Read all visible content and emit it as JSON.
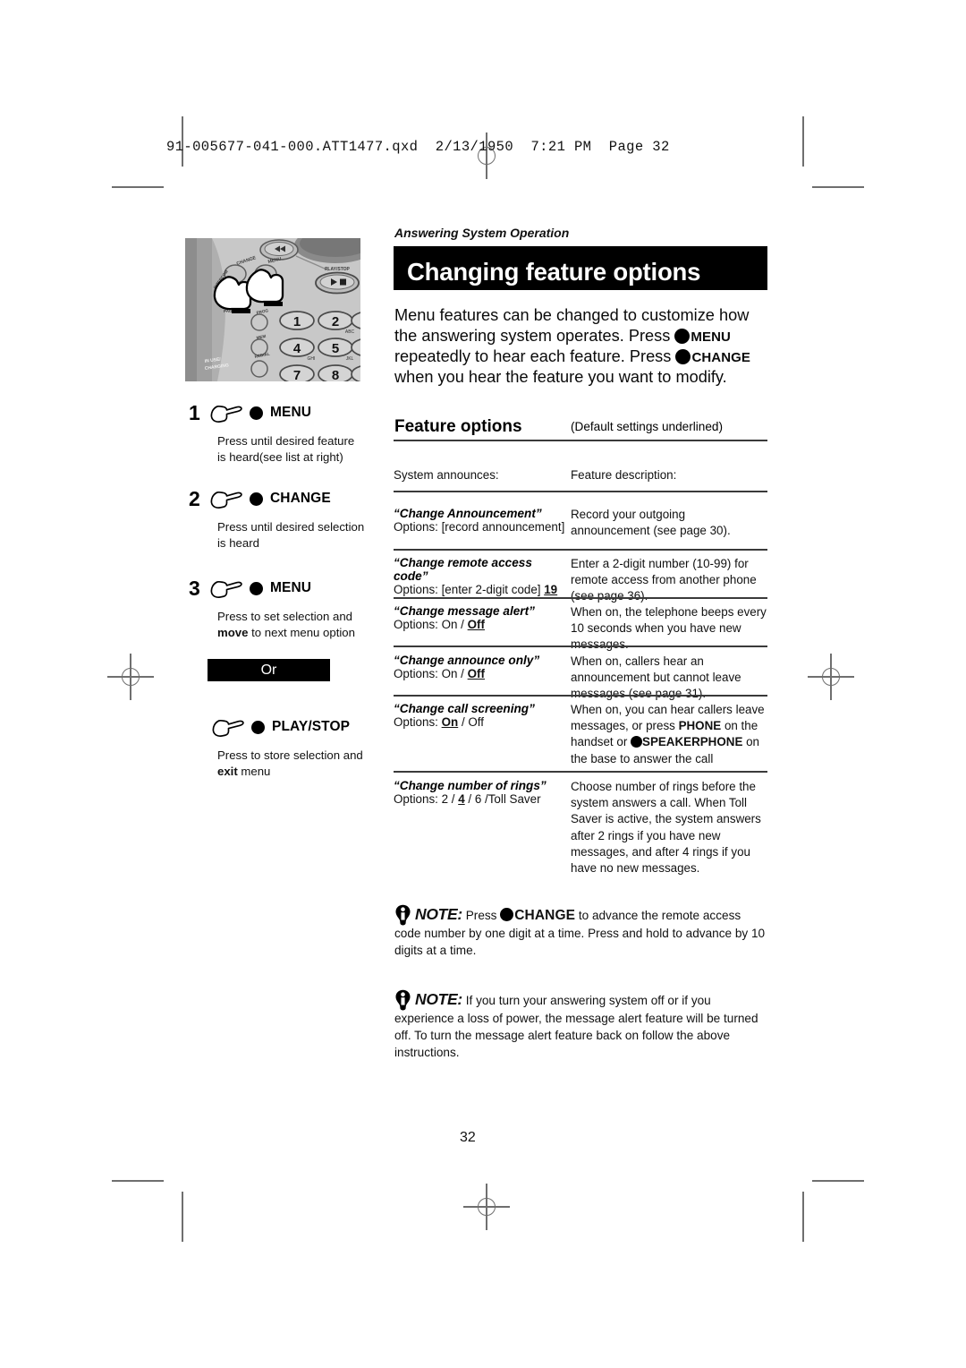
{
  "print_slug": "91-005677-041-000.ATT1477.qxd  2/13/1950  7:21 PM  Page 32",
  "running_head": "Answering System Operation",
  "title": "Changing feature options",
  "intro": {
    "part1": "Menu features can be changed to customize how the answering system operates. Press",
    "key1": "MENU",
    "part2": "repeatedly to hear each feature. Press",
    "key2": "CHANGE",
    "part3": "when you hear the feature you want to modify."
  },
  "steps": [
    {
      "number": "1",
      "key": "MENU",
      "body_line1": "Press until desired feature",
      "body_line2": "is heard(see list at right)",
      "body_bold": ""
    },
    {
      "number": "2",
      "key": "CHANGE",
      "body_line1": "Press until desired selection",
      "body_line2": "is heard",
      "body_bold": ""
    },
    {
      "number": "3",
      "key": "MENU",
      "body_line1": "Press to set selection and",
      "body_bold": "move",
      "body_line2": "to next menu option"
    }
  ],
  "or_label": "Or",
  "alt_step": {
    "key": "PLAY/STOP",
    "body_line1": "Press to store selection and",
    "body_bold": "exit",
    "body_line2": "menu"
  },
  "phone_art": {
    "labels": [
      "CHANGE",
      "MENU",
      "PLAY/STOP",
      "INTERCOM",
      "PAGE",
      "PROG",
      "MEM",
      "REDIAL",
      "IN USE/CHARGING"
    ],
    "keys": [
      "1",
      "2",
      "4",
      "5",
      "7",
      "8"
    ],
    "key_letters": [
      "ABC",
      "GHI",
      "JKL"
    ]
  },
  "feature_options": {
    "heading": "Feature options",
    "note": "(Default settings underlined)",
    "col_a_header": "System announces:",
    "col_b_header": "Feature description:",
    "rows": [
      {
        "name": "“Change Announcement”",
        "options_prefix": "Options: [record announcement]",
        "options_default": "",
        "options_suffix": "",
        "description": "Record your outgoing announcement (see page 30)."
      },
      {
        "name": "“Change remote access code”",
        "options_prefix": "Options: [enter 2-digit code]",
        "options_default": "19",
        "options_suffix": "",
        "description": "Enter a 2-digit number (10-99) for remote access from another phone (see page 36)."
      },
      {
        "name": "“Change message alert”",
        "options_prefix": "Options: On /",
        "options_default": "Off",
        "options_suffix": "",
        "description": "When on, the telephone beeps every 10 seconds when you have new messages."
      },
      {
        "name": "“Change announce only”",
        "options_prefix": "Options: On /",
        "options_default": "Off",
        "options_suffix": "",
        "description": "When on, callers hear an announcement but cannot leave messages (see page 31)."
      },
      {
        "name": "“Change call screening”",
        "options_prefix": "Options:",
        "options_default": "On",
        "options_suffix": "/ Off",
        "description_part1": "When on, you can hear callers leave messages, or press",
        "description_key1": "PHONE",
        "description_part2": "on the handset or",
        "description_key2": "SPEAKERPHONE",
        "description_part3": "on the base to answer the call"
      },
      {
        "name": "“Change number of rings”",
        "options_prefix": "Options: 2 /",
        "options_default": "4",
        "options_suffix": "/ 6 /Toll Saver",
        "description": "Choose number of rings before the system answers a call. When Toll Saver is active, the system answers after 2 rings if you have new messages, and after 4 rings if you have no new messages."
      }
    ]
  },
  "notes": [
    {
      "label": "NOTE:",
      "part1": "Press",
      "key": "CHANGE",
      "part2": "to advance the remote access code number by one digit at a time. Press and hold to advance by 10 digits at a time."
    },
    {
      "label": "NOTE:",
      "part1": "If you turn your answering system off or if you experience a loss of power, the message alert feature will be turned off. To turn the message alert feature back on follow the above instructions.",
      "key": "",
      "part2": ""
    }
  ],
  "page_number": "32"
}
